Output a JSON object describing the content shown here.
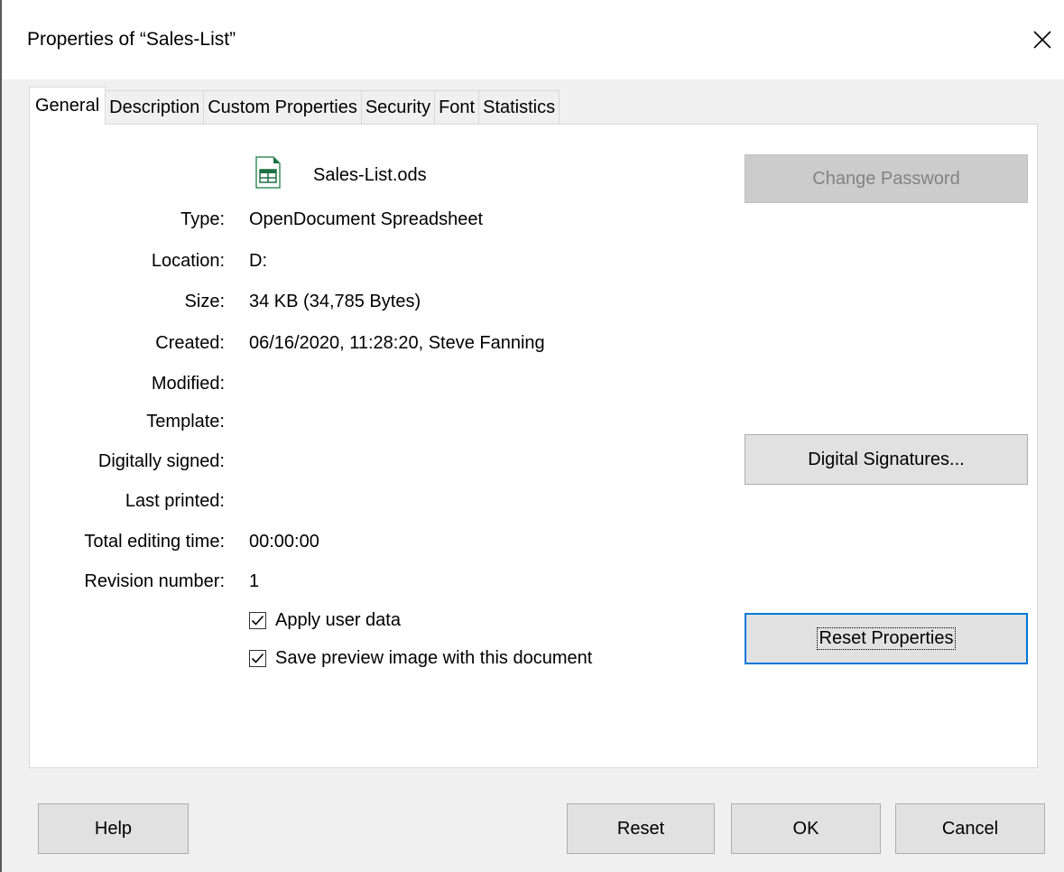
{
  "window": {
    "title": "Properties of “Sales-List”",
    "close_glyph": "✕"
  },
  "tabs": [
    {
      "label": "General",
      "active": true
    },
    {
      "label": "Description",
      "active": false
    },
    {
      "label": "Custom Properties",
      "active": false
    },
    {
      "label": "Security",
      "active": false
    },
    {
      "label": "Font",
      "active": false
    },
    {
      "label": "Statistics",
      "active": false
    }
  ],
  "general": {
    "file_icon": "spreadsheet-file-icon",
    "file_name": "Sales-List.ods",
    "fields": [
      {
        "label": "Type:",
        "value": "OpenDocument Spreadsheet"
      },
      {
        "label": "Location:",
        "value": "D:"
      },
      {
        "label": "Size:",
        "value": "34 KB (34,785 Bytes)"
      },
      {
        "label": "Created:",
        "value": "06/16/2020, 11:28:20, Steve Fanning"
      },
      {
        "label": "Modified:",
        "value": ""
      },
      {
        "label": "Template:",
        "value": ""
      },
      {
        "label": "Digitally signed:",
        "value": ""
      },
      {
        "label": "Last printed:",
        "value": ""
      },
      {
        "label": "Total editing time:",
        "value": "00:00:00"
      },
      {
        "label": "Revision number:",
        "value": "1"
      }
    ],
    "checkboxes": [
      {
        "label": "Apply user data",
        "checked": true
      },
      {
        "label": "Save preview image with this document",
        "checked": true
      }
    ],
    "change_password_label": "Change Password",
    "digital_signatures_label": "Digital Signatures...",
    "reset_properties_label": "Reset Properties"
  },
  "footer": {
    "help_label": "Help",
    "reset_label": "Reset",
    "ok_label": "OK",
    "cancel_label": "Cancel"
  },
  "colors": {
    "focus_border": "#0078d7",
    "icon_green": "#1e7145"
  }
}
